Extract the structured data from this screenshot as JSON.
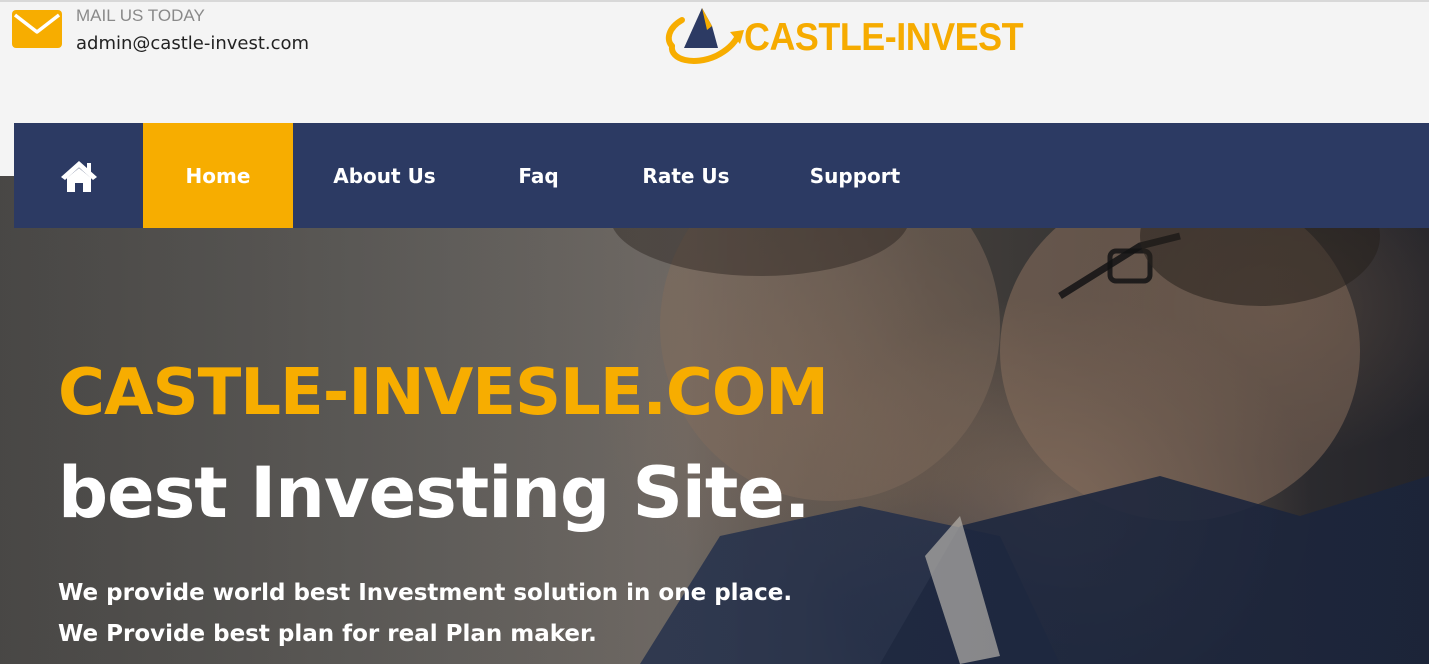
{
  "header": {
    "mail_label": "MAIL US TODAY",
    "mail_address": "admin@castle-invest.com",
    "logo_text": "CASTLE-INVEST"
  },
  "nav": {
    "items": [
      {
        "label": "Home",
        "active": true
      },
      {
        "label": "About Us",
        "active": false
      },
      {
        "label": "Faq",
        "active": false
      },
      {
        "label": "Rate Us",
        "active": false
      },
      {
        "label": "Support",
        "active": false
      }
    ]
  },
  "hero": {
    "headline": "CASTLE-INVESLE.COM",
    "subheadline": "best Investing Site.",
    "line1": "We provide world best Investment solution in one place.",
    "line2": "We Provide best plan for real Plan maker."
  },
  "colors": {
    "accent": "#f7ad00",
    "nav_background": "#2c3a63",
    "background": "#f4f4f4"
  },
  "icons": [
    "mail-icon",
    "castle-invest-logo",
    "home-icon"
  ]
}
